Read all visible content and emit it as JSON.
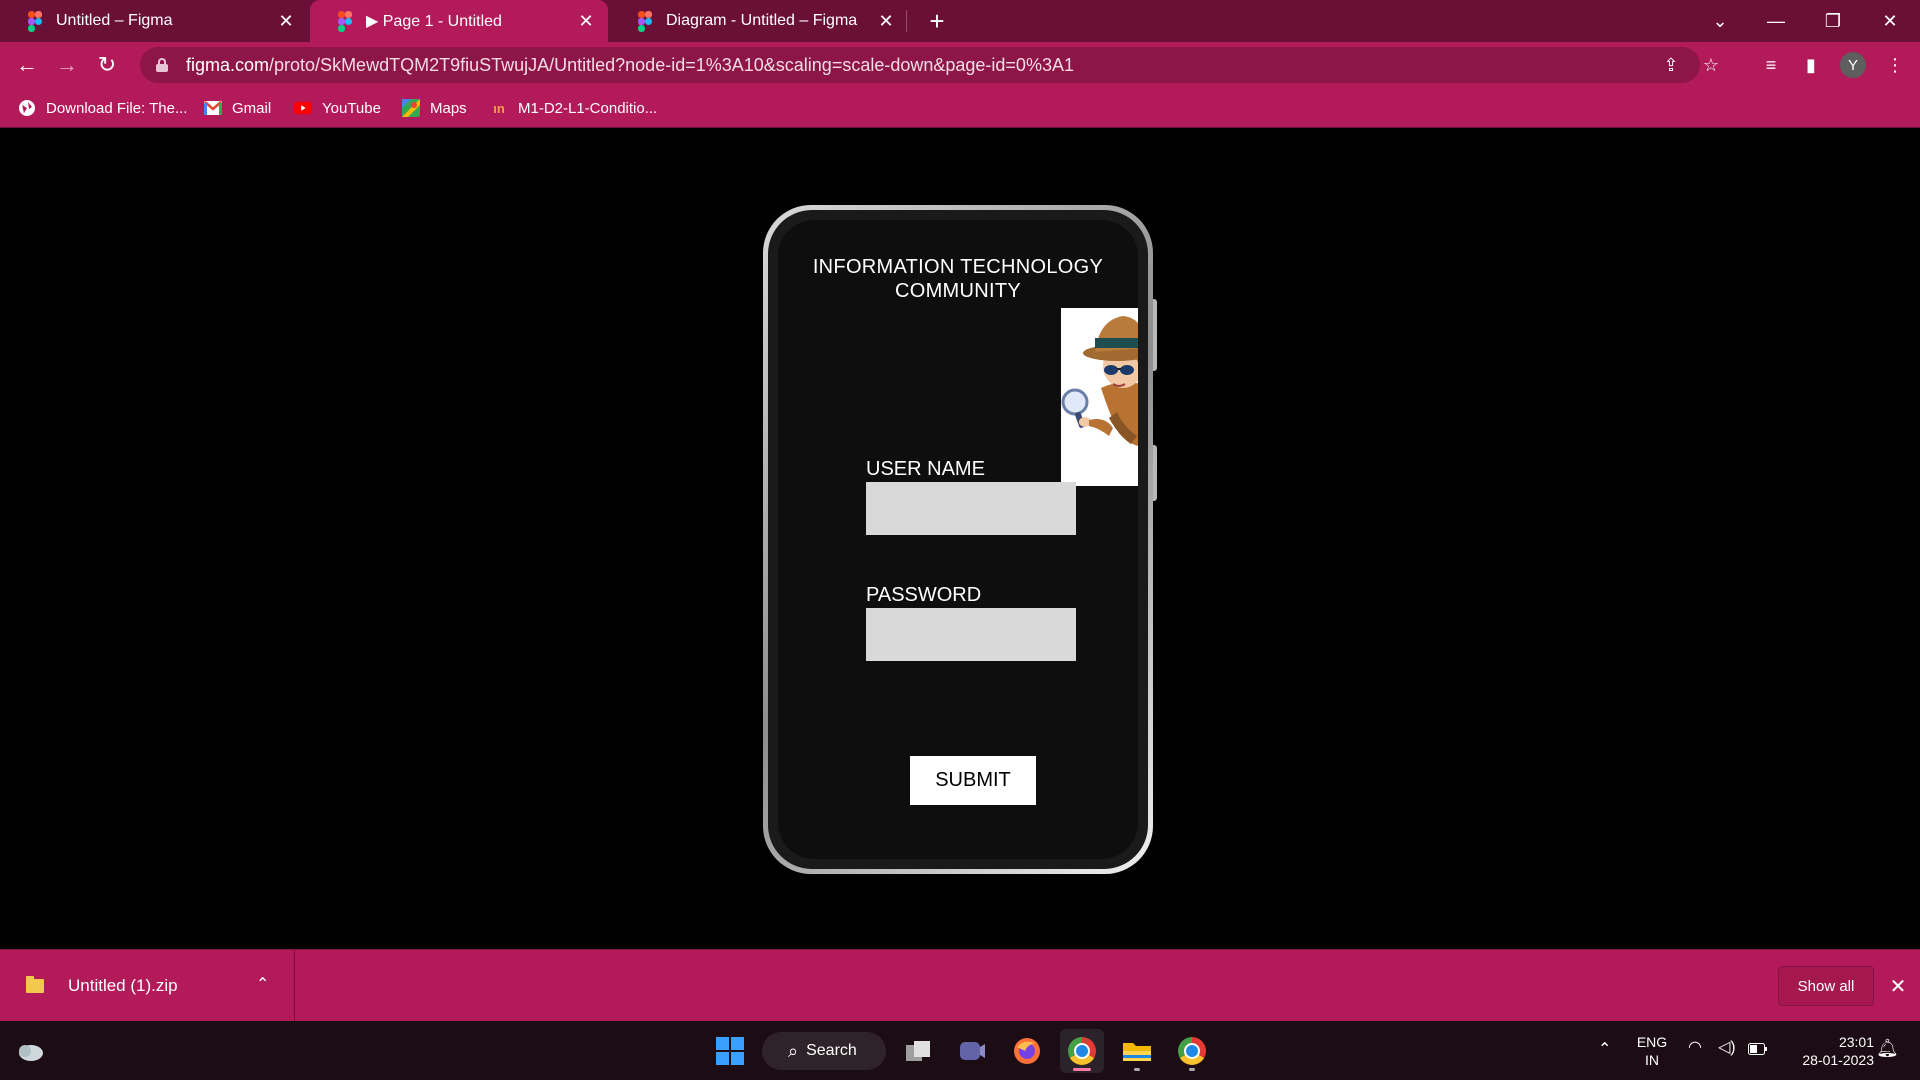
{
  "browser": {
    "tabs": [
      {
        "title": "Untitled – Figma",
        "active": false
      },
      {
        "title": "▶ Page 1 - Untitled",
        "active": true
      },
      {
        "title": "Diagram - Untitled – Figma",
        "active": false
      }
    ],
    "url_host": "figma.com",
    "url_path": "/proto/SkMewdTQM2T9fiuSTwujJA/Untitled?node-id=1%3A10&scaling=scale-down&page-id=0%3A1",
    "profile_initial": "Y",
    "bookmarks": [
      {
        "label": "Download File: The...",
        "icon": "globe-icon"
      },
      {
        "label": "Gmail",
        "icon": "gmail-icon"
      },
      {
        "label": "YouTube",
        "icon": "youtube-icon"
      },
      {
        "label": "Maps",
        "icon": "maps-icon"
      },
      {
        "label": "M1-D2-L1-Conditio...",
        "icon": "site-icon"
      }
    ],
    "accent_color": "#b31a5a",
    "tabstrip_color": "#6a1037"
  },
  "app": {
    "title_line1": "INFORMATION TECHNOLOGY",
    "title_line2": "COMMUNITY",
    "username_label": "USER NAME",
    "username_value": "",
    "password_label": "PASSWORD",
    "password_value": "",
    "submit_label": "SUBMIT",
    "illustration": "detective-with-magnifier"
  },
  "downloads": {
    "file_name": "Untitled (1).zip",
    "show_all_label": "Show all"
  },
  "taskbar": {
    "search_label": "Search",
    "language_line1": "ENG",
    "language_line2": "IN",
    "time": "23:01",
    "date": "28-01-2023"
  }
}
